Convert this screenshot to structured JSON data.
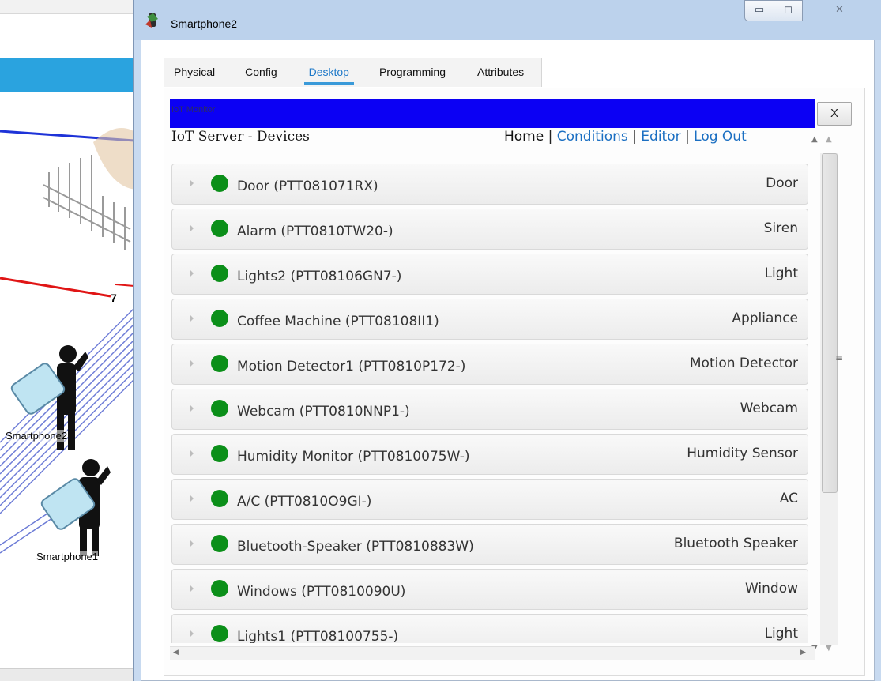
{
  "workspace": {
    "wire_number": "7",
    "device_labels": [
      "Smartphone2",
      "Smartphone1"
    ]
  },
  "window": {
    "title": "Smartphone2",
    "minimize_glyph": "▭",
    "maximize_glyph": "◻",
    "close_glyph": "✕"
  },
  "tabs": [
    {
      "label": "Physical"
    },
    {
      "label": "Config"
    },
    {
      "label": "Desktop"
    },
    {
      "label": "Programming"
    },
    {
      "label": "Attributes"
    }
  ],
  "active_tab": "Desktop",
  "iot_monitor": {
    "bar_title": "IoT Monitor",
    "close_label": "X",
    "bar_color": "#0b00f4"
  },
  "server": {
    "title": "IoT Server - Devices",
    "nav": {
      "home": "Home",
      "conditions": "Conditions",
      "editor": "Editor",
      "logout": "Log Out",
      "separator": "|"
    }
  },
  "status_color": "#0b8f19",
  "devices": [
    {
      "name": "Door (PTT081071RX)",
      "type": "Door"
    },
    {
      "name": "Alarm (PTT0810TW20-)",
      "type": "Siren"
    },
    {
      "name": "Lights2 (PTT08106GN7-)",
      "type": "Light"
    },
    {
      "name": "Coffee Machine (PTT08108II1)",
      "type": "Appliance"
    },
    {
      "name": "Motion Detector1 (PTT0810P172-)",
      "type": "Motion Detector"
    },
    {
      "name": "Webcam (PTT0810NNP1-)",
      "type": "Webcam"
    },
    {
      "name": "Humidity Monitor (PTT0810075W-)",
      "type": "Humidity Sensor"
    },
    {
      "name": "A/C (PTT0810O9GI-)",
      "type": "AC"
    },
    {
      "name": "Bluetooth-Speaker (PTT0810883W)",
      "type": "Bluetooth Speaker"
    },
    {
      "name": "Windows (PTT0810090U)",
      "type": "Window"
    },
    {
      "name": "Lights1 (PTT08100755-)",
      "type": "Light"
    }
  ]
}
